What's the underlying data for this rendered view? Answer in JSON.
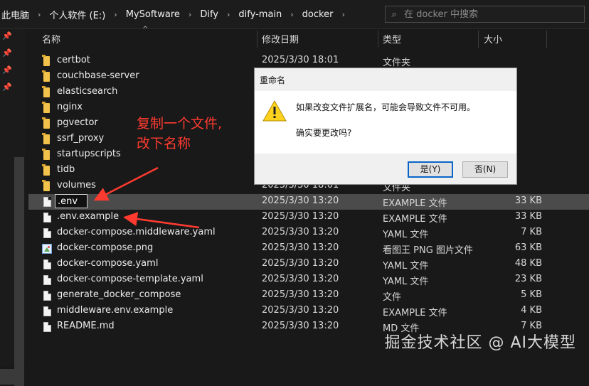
{
  "breadcrumb": [
    "此电脑",
    "个人软件 (E:)",
    "MySoftware",
    "Dify",
    "dify-main",
    "docker"
  ],
  "search": {
    "placeholder": "在 docker 中搜索"
  },
  "columns": {
    "name": "名称",
    "date": "修改日期",
    "type": "类型",
    "size": "大小"
  },
  "files": [
    {
      "name": "certbot",
      "date": "2025/3/30 18:01",
      "type": "文件夹",
      "size": "",
      "icon": "folder-icon"
    },
    {
      "name": "couchbase-server",
      "date": "",
      "type": "",
      "size": "",
      "icon": "folder-icon"
    },
    {
      "name": "elasticsearch",
      "date": "",
      "type": "",
      "size": "",
      "icon": "folder-icon"
    },
    {
      "name": "nginx",
      "date": "",
      "type": "",
      "size": "",
      "icon": "folder-icon"
    },
    {
      "name": "pgvector",
      "date": "",
      "type": "",
      "size": "",
      "icon": "folder-icon"
    },
    {
      "name": "ssrf_proxy",
      "date": "",
      "type": "",
      "size": "",
      "icon": "folder-icon"
    },
    {
      "name": "startupscripts",
      "date": "",
      "type": "",
      "size": "",
      "icon": "folder-icon"
    },
    {
      "name": "tidb",
      "date": "",
      "type": "",
      "size": "",
      "icon": "folder-icon"
    },
    {
      "name": "volumes",
      "date": "2025/3/30 18:01",
      "type": "文件夹",
      "size": "",
      "icon": "folder-icon"
    },
    {
      "name": ".env",
      "date": "2025/3/30 13:20",
      "type": "EXAMPLE 文件",
      "size": "33 KB",
      "icon": "document-icon",
      "renaming": true
    },
    {
      "name": ".env.example",
      "date": "2025/3/30 13:20",
      "type": "EXAMPLE 文件",
      "size": "33 KB",
      "icon": "document-icon"
    },
    {
      "name": "docker-compose.middleware.yaml",
      "date": "2025/3/30 13:20",
      "type": "YAML 文件",
      "size": "7 KB",
      "icon": "document-icon"
    },
    {
      "name": "docker-compose.png",
      "date": "2025/3/30 13:20",
      "type": "看图王 PNG 图片文件",
      "size": "63 KB",
      "icon": "image-icon"
    },
    {
      "name": "docker-compose.yaml",
      "date": "2025/3/30 13:20",
      "type": "YAML 文件",
      "size": "48 KB",
      "icon": "document-icon"
    },
    {
      "name": "docker-compose-template.yaml",
      "date": "2025/3/30 13:20",
      "type": "YAML 文件",
      "size": "23 KB",
      "icon": "document-icon"
    },
    {
      "name": "generate_docker_compose",
      "date": "2025/3/30 13:20",
      "type": "文件",
      "size": "5 KB",
      "icon": "document-icon"
    },
    {
      "name": "middleware.env.example",
      "date": "2025/3/30 13:20",
      "type": "EXAMPLE 文件",
      "size": "4 KB",
      "icon": "document-icon"
    },
    {
      "name": "README.md",
      "date": "2025/3/30 13:20",
      "type": "MD 文件",
      "size": "7 KB",
      "icon": "document-icon"
    }
  ],
  "annotation": {
    "line1": "复制一个文件,",
    "line2": "改下名称",
    "color": "#ff3b30"
  },
  "dialog": {
    "title": "重命名",
    "message": "如果改变文件扩展名，可能会导致文件不可用。",
    "question": "确实要更改吗?",
    "yes_label": "是(Y)",
    "no_label": "否(N)",
    "icon": "warning-icon"
  },
  "watermark": "掘金技术社区 @ AI大模型"
}
